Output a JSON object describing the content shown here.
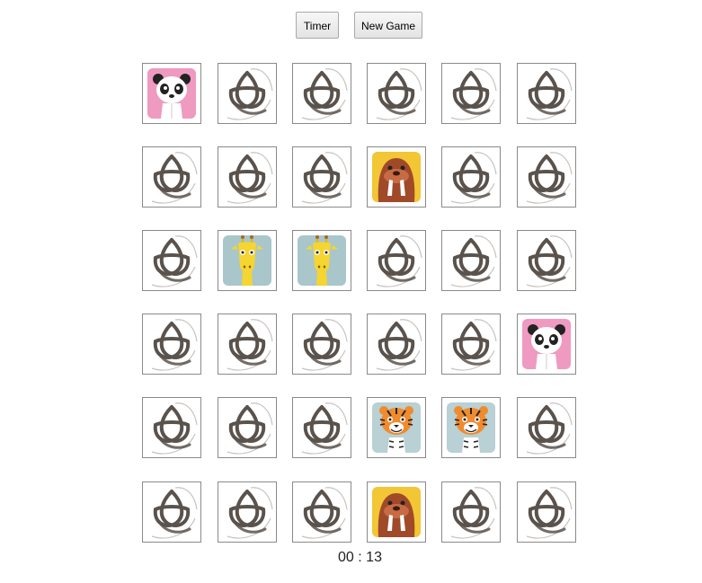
{
  "controls": {
    "timer_label": "Timer",
    "new_game_label": "New Game"
  },
  "timer": {
    "display": "00 : 13"
  },
  "board": {
    "rows": 6,
    "cols": 6,
    "back_icon": "triquetra-icon",
    "cells": [
      [
        "panda",
        "back",
        "back",
        "back",
        "back",
        "back"
      ],
      [
        "back",
        "back",
        "back",
        "walrus",
        "back",
        "back"
      ],
      [
        "back",
        "giraffe",
        "giraffe",
        "back",
        "back",
        "back"
      ],
      [
        "back",
        "back",
        "back",
        "back",
        "back",
        "panda"
      ],
      [
        "back",
        "back",
        "back",
        "tiger",
        "tiger",
        "back"
      ],
      [
        "back",
        "back",
        "back",
        "walrus",
        "back",
        "back"
      ]
    ]
  },
  "colors": {
    "panda_bg": "#ef9ac0",
    "walrus_bg": "#f2c634",
    "giraffe_bg": "#a9c6cb",
    "tiger_bg": "#b9d0d4",
    "back_stroke": "#5a524c"
  }
}
